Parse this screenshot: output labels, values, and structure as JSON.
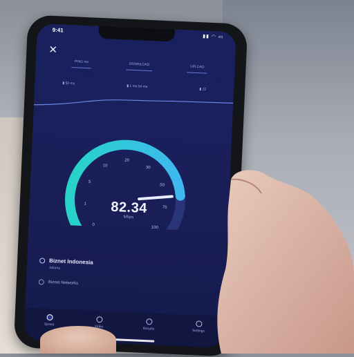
{
  "status_bar": {
    "time": "9:41",
    "icons": "▮▮ ◠ ▭"
  },
  "header": {
    "close_label": "✕"
  },
  "tabs": [
    {
      "label": "PING ms"
    },
    {
      "label": "DOWNLOAD"
    },
    {
      "label": "UPLOAD"
    }
  ],
  "stats": [
    {
      "label": "▮ 52 ms"
    },
    {
      "label": "▮ 1 ms 54 ms"
    },
    {
      "label": "▮ 12"
    }
  ],
  "gauge": {
    "value": 82.34,
    "display": "82.34",
    "unit": "Mbps",
    "scale_labels": [
      "0",
      "1",
      "5",
      "10",
      "20",
      "30",
      "50",
      "75",
      "100"
    ],
    "fill_fraction": 0.82,
    "colors": {
      "arc_start": "#27d3c8",
      "arc_end": "#3fb8f0",
      "track": "#2a3478",
      "needle": "#e8ecff"
    }
  },
  "provider": {
    "name": "Biznet Indonesia",
    "sub": "Jakarta"
  },
  "server": {
    "name": "Biznet Networks"
  },
  "bottom_nav": [
    {
      "label": "Speed"
    },
    {
      "label": "Video"
    },
    {
      "label": "Results"
    },
    {
      "label": "Settings"
    }
  ]
}
